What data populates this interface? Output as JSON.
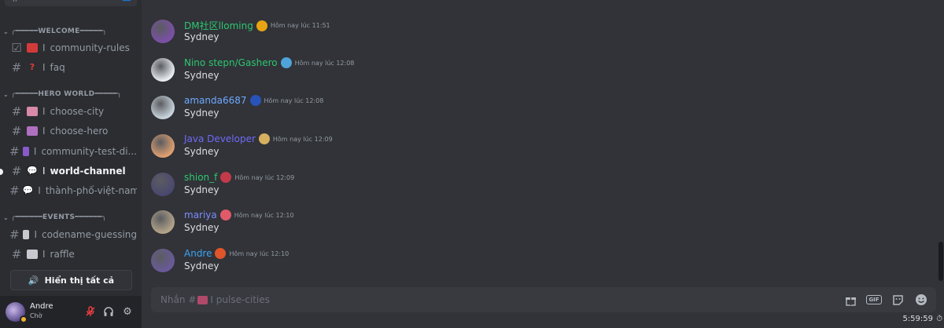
{
  "sidebar": {
    "categories": {
      "welcome": "WELCOME",
      "hero_world": "HERO WORLD",
      "events": "EVENTS"
    },
    "channels": {
      "community_rules": "community-rules",
      "faq": "faq",
      "choose_city": "choose-city",
      "choose_hero": "choose-hero",
      "community_test": "community-test-di...",
      "world_channel": "world-channel",
      "thanh_pho": "thành-phố-việt-nam",
      "codename": "codename-guessing",
      "raffle": "raffle"
    },
    "separator": "I",
    "show_all": "Hiển thị tất cả"
  },
  "user": {
    "name": "Andre",
    "status": "Chờ"
  },
  "messages": [
    {
      "author": "DM社区lloming",
      "time": "Hôm nay lúc 11:51",
      "text": "Sydney",
      "name_color": "#2dc770",
      "avatar": "#7b4fa8",
      "badge": "#e8a412"
    },
    {
      "author": "Nino stepn/Gashero",
      "time": "Hôm nay lúc 12:08",
      "text": "Sydney",
      "name_color": "#2dc770",
      "avatar": "#e9eef2",
      "badge": "#4fa3d9"
    },
    {
      "author": "amanda6687",
      "time": "Hôm nay lúc 12:08",
      "text": "Sydney",
      "name_color": "#6fa8ff",
      "avatar": "#c9d4dd",
      "badge": "#2853b8"
    },
    {
      "author": "Java Developer",
      "time": "Hôm nay lúc 12:09",
      "text": "Sydney",
      "name_color": "#6f6af8",
      "avatar": "#e0a070",
      "badge": "#d6b060"
    },
    {
      "author": "shion_f",
      "time": "Hôm nay lúc 12:09",
      "text": "Sydney",
      "name_color": "#2dc770",
      "avatar": "#4a4870",
      "badge": "#c33a4a"
    },
    {
      "author": "mariya",
      "time": "Hôm nay lúc 12:10",
      "text": "Sydney",
      "name_color": "#7b8cff",
      "avatar": "#b4a48a",
      "badge": "#e05a6a"
    },
    {
      "author": "Andre",
      "time": "Hôm nay lúc 12:10",
      "text": "Sydney",
      "name_color": "#3ba4f2",
      "avatar": "#6a5a9a",
      "badge": "#e0552a"
    }
  ],
  "composer": {
    "prefix": "Nhắn #",
    "channel": "I pulse-cities"
  },
  "clock": "5:59:59"
}
